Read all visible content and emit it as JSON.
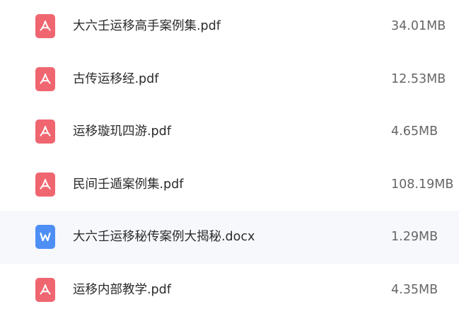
{
  "files": [
    {
      "name": "大六壬运移高手案例集.pdf",
      "size": "34.01MB",
      "type": "pdf",
      "icon": "pdf-file-icon"
    },
    {
      "name": "古传运移经.pdf",
      "size": "12.53MB",
      "type": "pdf",
      "icon": "pdf-file-icon"
    },
    {
      "name": "运移璇玑四游.pdf",
      "size": "4.65MB",
      "type": "pdf",
      "icon": "pdf-file-icon"
    },
    {
      "name": "民间壬遁案例集.pdf",
      "size": "108.19MB",
      "type": "pdf",
      "icon": "pdf-file-icon"
    },
    {
      "name": "大六壬运移秘传案例大揭秘.docx",
      "size": "1.29MB",
      "type": "docx",
      "icon": "word-file-icon",
      "highlighted": true
    },
    {
      "name": "运移内部教学.pdf",
      "size": "4.35MB",
      "type": "pdf",
      "icon": "pdf-file-icon"
    }
  ],
  "colors": {
    "pdf_icon": "#f06670",
    "word_icon": "#4e8ff5",
    "row_highlight": "#f6f8fc",
    "name_text": "#2b2b2b",
    "size_text": "#666666"
  }
}
